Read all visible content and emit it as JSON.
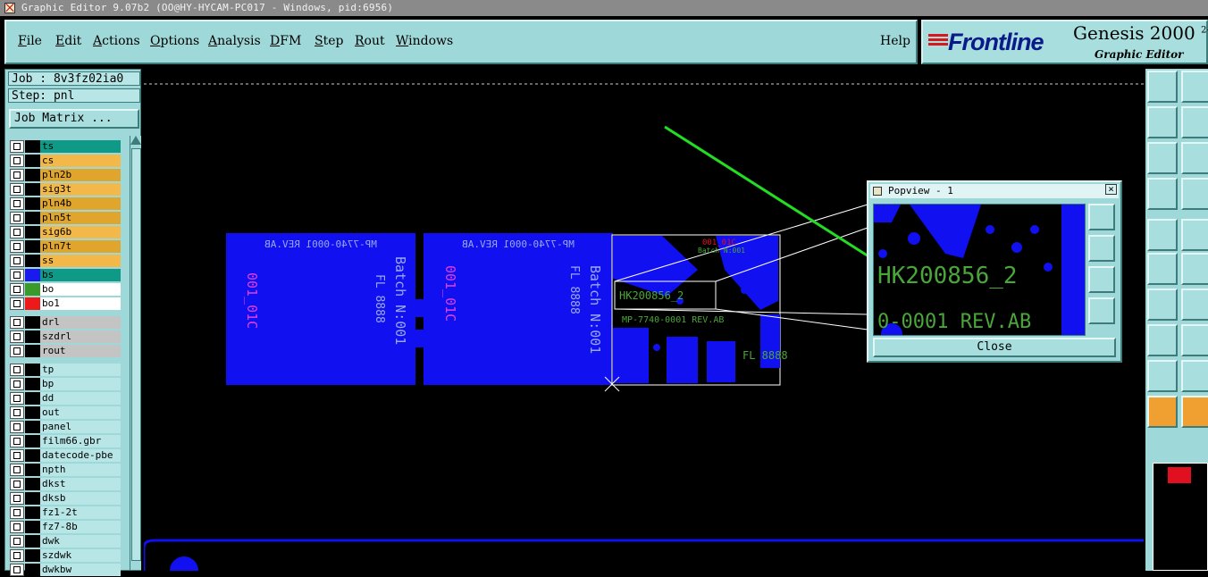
{
  "window": {
    "title": "Graphic Editor 9.07b2 (OO@HY-HYCAM-PC017 - Windows, pid:6956)"
  },
  "menu": {
    "items": [
      {
        "label": "File",
        "underline": "F",
        "rest": "ile"
      },
      {
        "label": "Edit",
        "underline": "E",
        "rest": "dit"
      },
      {
        "label": "Actions",
        "underline": "A",
        "rest": "ctions"
      },
      {
        "label": "Options",
        "underline": "O",
        "rest": "ptions"
      },
      {
        "label": "Analysis",
        "underline": "A",
        "rest": "nalysis"
      },
      {
        "label": "DFM",
        "underline": "D",
        "rest": "FM"
      },
      {
        "label": "Step",
        "underline": "S",
        "rest": "tep"
      },
      {
        "label": "Rout",
        "underline": "R",
        "rest": "out"
      },
      {
        "label": "Windows",
        "underline": "W",
        "rest": "indows"
      }
    ],
    "help": "Help"
  },
  "brand": {
    "logo": "Frontline",
    "product": "Genesis 2000",
    "product_suffix": "2-",
    "subtitle": "Graphic Editor"
  },
  "job": {
    "job_label": "Job : 8v3fz02ia0",
    "step_label": "Step: pnl",
    "matrix_button": "Job Matrix ..."
  },
  "layers": [
    {
      "name": "ts",
      "bg": "#0e9a86",
      "swatch": "#000000"
    },
    {
      "name": "cs",
      "bg": "#f2b84a",
      "swatch": "#000000"
    },
    {
      "name": "pln2b",
      "bg": "#e0a52c",
      "swatch": "#000000"
    },
    {
      "name": "sig3t",
      "bg": "#f2b84a",
      "swatch": "#000000"
    },
    {
      "name": "pln4b",
      "bg": "#e0a52c",
      "swatch": "#000000"
    },
    {
      "name": "pln5t",
      "bg": "#e0a52c",
      "swatch": "#000000"
    },
    {
      "name": "sig6b",
      "bg": "#f2b84a",
      "swatch": "#000000"
    },
    {
      "name": "pln7t",
      "bg": "#e0a52c",
      "swatch": "#000000"
    },
    {
      "name": "ss",
      "bg": "#f2b84a",
      "swatch": "#000000"
    },
    {
      "name": "bs",
      "bg": "#0e9a86",
      "swatch": "#1a1aee"
    },
    {
      "name": "bo",
      "bg": "#ffffff",
      "swatch": "#3a9a2a"
    },
    {
      "name": "bo1",
      "bg": "#ffffff",
      "swatch": "#ee1a1a"
    },
    {
      "name": "drl",
      "bg": "#c4c4c4",
      "swatch": "#000000"
    },
    {
      "name": "szdrl",
      "bg": "#c4c4c4",
      "swatch": "#000000"
    },
    {
      "name": "rout",
      "bg": "#c4c4c4",
      "swatch": "#000000"
    },
    {
      "name": "tp",
      "bg": "#b8e6e6",
      "swatch": "#000000"
    },
    {
      "name": "bp",
      "bg": "#b8e6e6",
      "swatch": "#000000"
    },
    {
      "name": "dd",
      "bg": "#b8e6e6",
      "swatch": "#000000"
    },
    {
      "name": "out",
      "bg": "#b8e6e6",
      "swatch": "#000000"
    },
    {
      "name": "panel",
      "bg": "#b8e6e6",
      "swatch": "#000000"
    },
    {
      "name": "film66.gbr",
      "bg": "#b8e6e6",
      "swatch": "#000000"
    },
    {
      "name": "datecode-pbe",
      "bg": "#b8e6e6",
      "swatch": "#000000"
    },
    {
      "name": "npth",
      "bg": "#b8e6e6",
      "swatch": "#000000"
    },
    {
      "name": "dkst",
      "bg": "#b8e6e6",
      "swatch": "#000000"
    },
    {
      "name": "dksb",
      "bg": "#b8e6e6",
      "swatch": "#000000"
    },
    {
      "name": "fz1-2t",
      "bg": "#b8e6e6",
      "swatch": "#000000"
    },
    {
      "name": "fz7-8b",
      "bg": "#b8e6e6",
      "swatch": "#000000"
    },
    {
      "name": "dwk",
      "bg": "#b8e6e6",
      "swatch": "#000000"
    },
    {
      "name": "szdwk",
      "bg": "#b8e6e6",
      "swatch": "#000000"
    },
    {
      "name": "dwkbw",
      "bg": "#b8e6e6",
      "swatch": "#000000"
    }
  ],
  "canvas_text": {
    "part_no": "MP-7740-0001 REV.AB",
    "lot_code": "001_01C",
    "fl_text": "FL 8888",
    "batch_text": "Batch N:001",
    "serial": "HK200856_2"
  },
  "popview": {
    "title": "Popview - 1",
    "close_label": "Close",
    "serial": "HK200856_2",
    "part_no": "0-0001 REV.AB"
  },
  "colors": {
    "cyan_ui": "#9fd8d8",
    "board_blue": "#1010f0",
    "silk_green": "#4aa63a",
    "pointer_green": "#22dd22",
    "mark_red": "#e01020"
  }
}
